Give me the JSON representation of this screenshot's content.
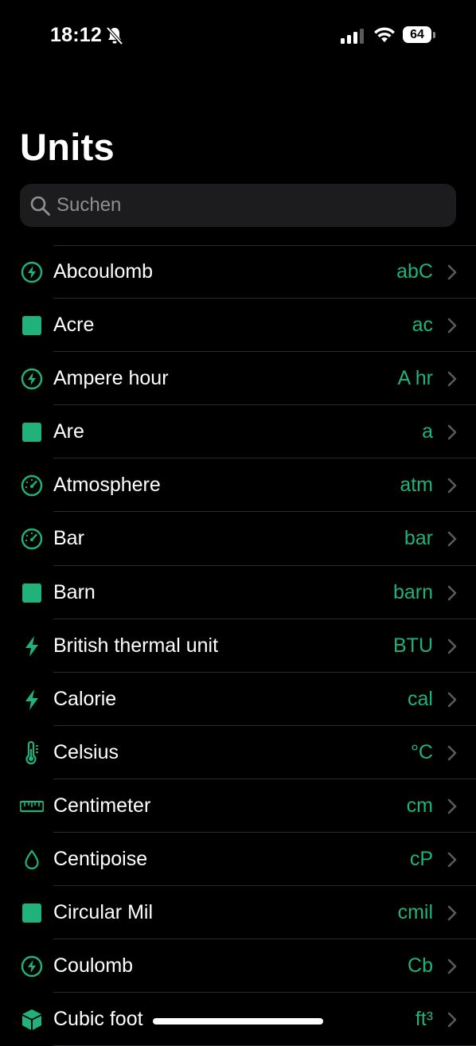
{
  "status_bar": {
    "time": "18:12",
    "battery": "64",
    "icons": [
      "bell-slash-icon",
      "cellular-signal-icon",
      "wifi-icon",
      "battery-icon"
    ]
  },
  "title": "Units",
  "search": {
    "placeholder": "Suchen",
    "value": ""
  },
  "colors": {
    "accent": "#21b27c",
    "background": "#000000",
    "search_background": "#1c1c1e",
    "separator": "#2a2a2c",
    "chevron": "#5a5a5e"
  },
  "units": [
    {
      "name": "Abcoulomb",
      "symbol": "abC",
      "icon": "bolt-circle-icon"
    },
    {
      "name": "Acre",
      "symbol": "ac",
      "icon": "square-icon"
    },
    {
      "name": "Ampere hour",
      "symbol": "A hr",
      "icon": "bolt-circle-icon"
    },
    {
      "name": "Are",
      "symbol": "a",
      "icon": "square-icon"
    },
    {
      "name": "Atmosphere",
      "symbol": "atm",
      "icon": "gauge-icon"
    },
    {
      "name": "Bar",
      "symbol": "bar",
      "icon": "gauge-icon"
    },
    {
      "name": "Barn",
      "symbol": "barn",
      "icon": "square-icon"
    },
    {
      "name": "British thermal unit",
      "symbol": "BTU",
      "icon": "bolt-icon"
    },
    {
      "name": "Calorie",
      "symbol": "cal",
      "icon": "bolt-icon"
    },
    {
      "name": "Celsius",
      "symbol": "°C",
      "icon": "thermometer-icon"
    },
    {
      "name": "Centimeter",
      "symbol": "cm",
      "icon": "ruler-icon"
    },
    {
      "name": "Centipoise",
      "symbol": "cP",
      "icon": "drop-icon"
    },
    {
      "name": "Circular Mil",
      "symbol": "cmil",
      "icon": "square-icon"
    },
    {
      "name": "Coulomb",
      "symbol": "Cb",
      "icon": "bolt-circle-icon"
    },
    {
      "name": "Cubic foot",
      "symbol": "ft³",
      "icon": "cube-icon"
    }
  ]
}
